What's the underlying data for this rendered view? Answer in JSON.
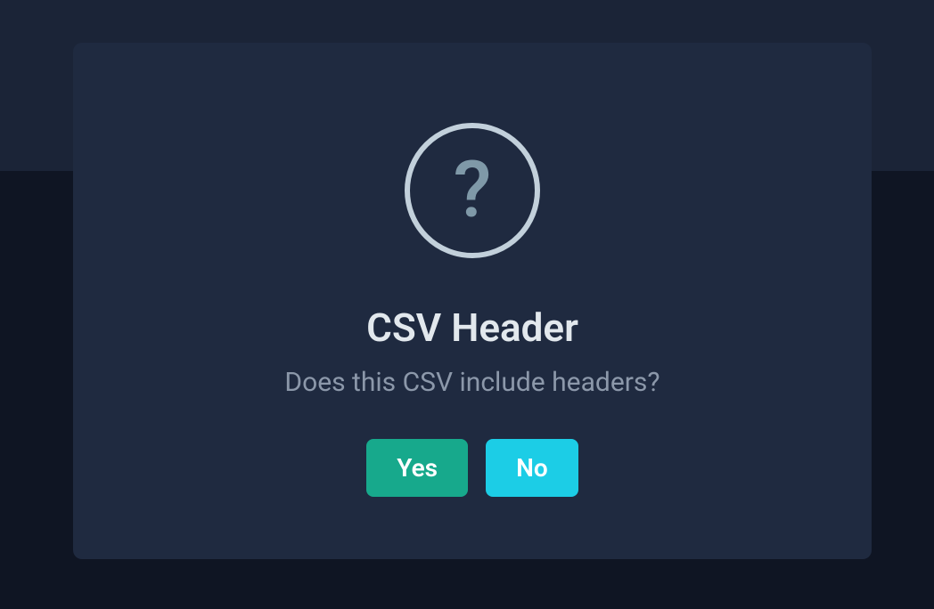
{
  "modal": {
    "title": "CSV Header",
    "message": "Does this CSV include headers?",
    "confirm_label": "Yes",
    "cancel_label": "No"
  }
}
